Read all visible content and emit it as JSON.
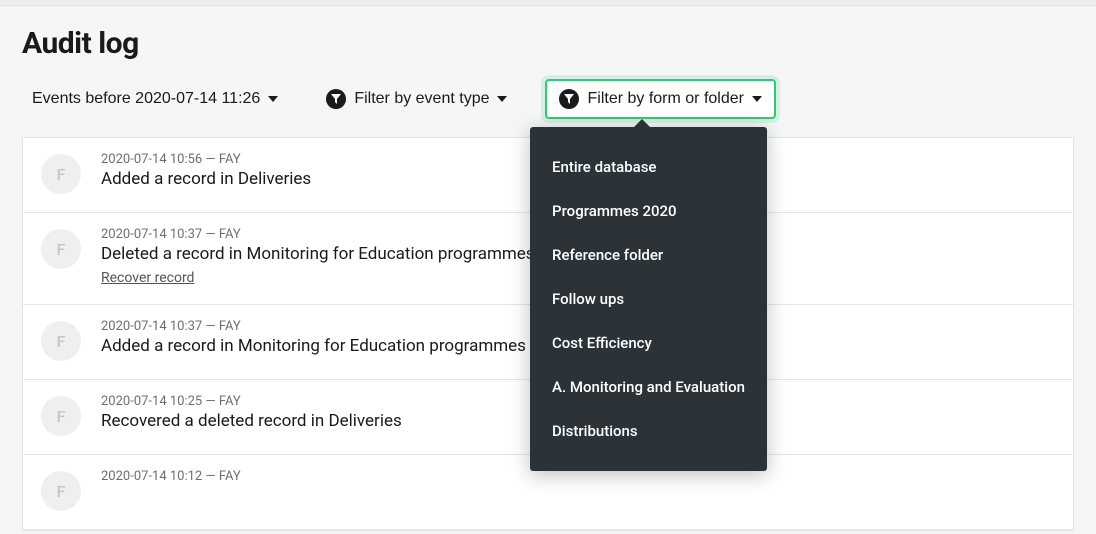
{
  "page_title": "Audit log",
  "filters": {
    "date": "Events before 2020-07-14 11:26",
    "event_type": "Filter by event type",
    "form_folder": "Filter by form or folder"
  },
  "avatar_letter": "F",
  "events": [
    {
      "meta": "2020-07-14 10:56 — FAY",
      "desc": "Added a record in Deliveries",
      "action": null
    },
    {
      "meta": "2020-07-14 10:37 — FAY",
      "desc": "Deleted a record in Monitoring for Education programmes",
      "action": "Recover record"
    },
    {
      "meta": "2020-07-14 10:37 — FAY",
      "desc": "Added a record in Monitoring for Education programmes",
      "action": null
    },
    {
      "meta": "2020-07-14 10:25 — FAY",
      "desc": "Recovered a deleted record in Deliveries",
      "action": null
    },
    {
      "meta": "2020-07-14 10:12 — FAY",
      "desc": "",
      "action": null
    }
  ],
  "dropdown_items": [
    "Entire database",
    "Programmes 2020",
    "Reference folder",
    "Follow ups",
    "Cost Efficiency",
    "A. Monitoring and Evaluation",
    "Distributions"
  ]
}
